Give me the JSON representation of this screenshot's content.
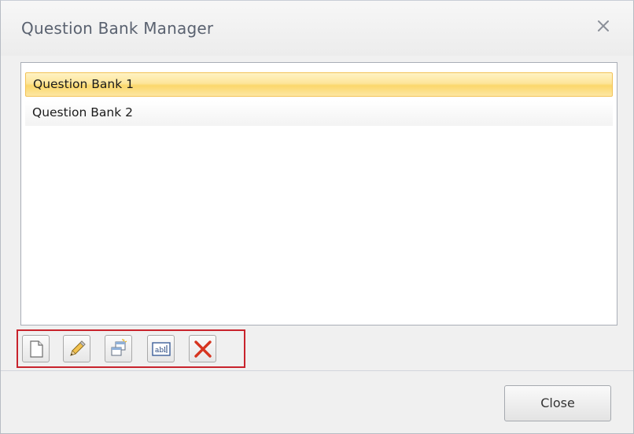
{
  "window": {
    "title": "Question Bank Manager",
    "close_icon": "close-icon"
  },
  "list": {
    "items": [
      {
        "label": "Question Bank 1",
        "selected": true
      },
      {
        "label": "Question Bank 2",
        "selected": false
      }
    ]
  },
  "toolbar": {
    "buttons": [
      {
        "name": "new",
        "icon": "new-document-icon"
      },
      {
        "name": "edit",
        "icon": "pencil-icon"
      },
      {
        "name": "copy",
        "icon": "duplicate-icon"
      },
      {
        "name": "rename",
        "icon": "rename-textfield-icon"
      },
      {
        "name": "delete",
        "icon": "delete-x-icon"
      }
    ],
    "highlight_color": "#c8232c"
  },
  "footer": {
    "close_label": "Close"
  },
  "colors": {
    "selection": "#fbd76b",
    "title_text": "#5a6270"
  }
}
